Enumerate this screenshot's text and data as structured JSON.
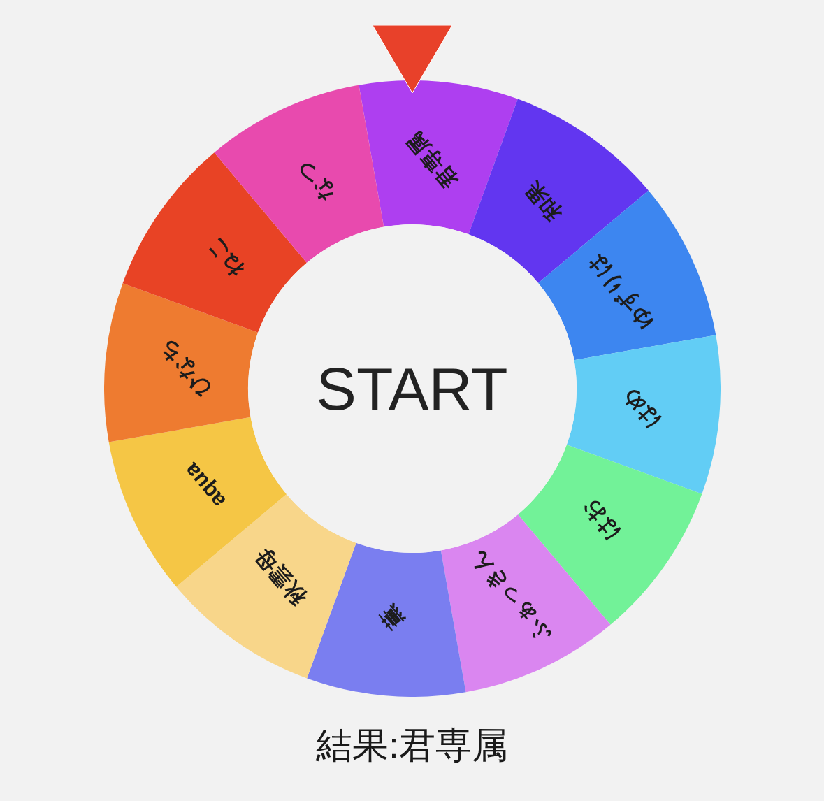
{
  "segments": [
    {
      "label": "君専属",
      "color": "#ae3ff0"
    },
    {
      "label": "和果",
      "color": "#6236f0"
    },
    {
      "label": "ゆずりは",
      "color": "#3d86f0"
    },
    {
      "label": "はめ",
      "color": "#62cdf5"
    },
    {
      "label": "はお",
      "color": "#72f298"
    },
    {
      "label": "ふぁっきん",
      "color": "#da86f0"
    },
    {
      "label": "薫",
      "color": "#7a7ef0"
    },
    {
      "label": "秋雲母",
      "color": "#f8d68a"
    },
    {
      "label": "aqua",
      "color": "#f5c645"
    },
    {
      "label": "ひなち",
      "color": "#ee7b30"
    },
    {
      "label": "ねこ",
      "color": "#e84325"
    },
    {
      "label": "なつ",
      "color": "#e84aae"
    }
  ],
  "start_button": {
    "label": "START"
  },
  "result": "結果:君専属"
}
